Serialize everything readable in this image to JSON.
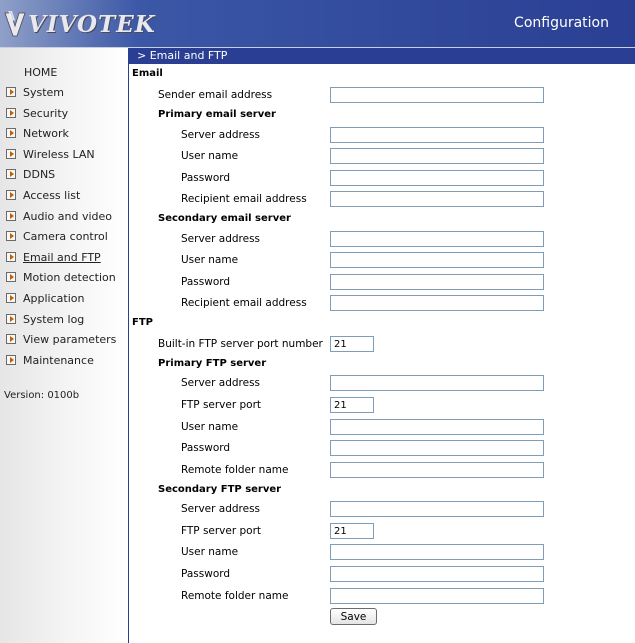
{
  "header": {
    "logo_text": "VIVOTEK",
    "title": "Configuration"
  },
  "sidebar": {
    "home": "HOME",
    "items": [
      {
        "label": "System"
      },
      {
        "label": "Security"
      },
      {
        "label": "Network"
      },
      {
        "label": "Wireless LAN"
      },
      {
        "label": "DDNS"
      },
      {
        "label": "Access list"
      },
      {
        "label": "Audio and video"
      },
      {
        "label": "Camera control"
      },
      {
        "label": "Email and FTP"
      },
      {
        "label": "Motion detection"
      },
      {
        "label": "Application"
      },
      {
        "label": "System log"
      },
      {
        "label": "View parameters"
      },
      {
        "label": "Maintenance"
      }
    ],
    "version": "Version: 0100b"
  },
  "section": {
    "title": "> Email and FTP"
  },
  "email": {
    "heading": "Email",
    "sender_label": "Sender email address",
    "sender_value": "",
    "primary": {
      "heading": "Primary email server",
      "server_label": "Server address",
      "server_value": "",
      "user_label": "User name",
      "user_value": "",
      "password_label": "Password",
      "password_value": "",
      "recipient_label": "Recipient email address",
      "recipient_value": ""
    },
    "secondary": {
      "heading": "Secondary email server",
      "server_label": "Server address",
      "server_value": "",
      "user_label": "User name",
      "user_value": "",
      "password_label": "Password",
      "password_value": "",
      "recipient_label": "Recipient email address",
      "recipient_value": ""
    }
  },
  "ftp": {
    "heading": "FTP",
    "builtin_port_label": "Built-in FTP server port number",
    "builtin_port_value": "21",
    "primary": {
      "heading": "Primary FTP server",
      "server_label": "Server address",
      "server_value": "",
      "port_label": "FTP server port",
      "port_value": "21",
      "user_label": "User name",
      "user_value": "",
      "password_label": "Password",
      "password_value": "",
      "folder_label": "Remote folder name",
      "folder_value": ""
    },
    "secondary": {
      "heading": "Secondary FTP server",
      "server_label": "Server address",
      "server_value": "",
      "port_label": "FTP server port",
      "port_value": "21",
      "user_label": "User name",
      "user_value": "",
      "password_label": "Password",
      "password_value": "",
      "folder_label": "Remote folder name",
      "folder_value": ""
    }
  },
  "save_label": "Save",
  "colors": {
    "header_blue": "#2a3f93",
    "section_bar": "#2a3f93",
    "menu_arrow": "#c06000"
  }
}
